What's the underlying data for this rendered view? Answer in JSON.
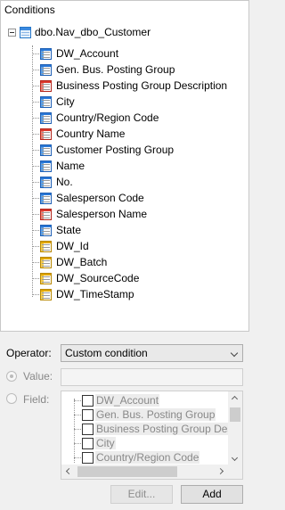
{
  "conditions": {
    "group_title": "Conditions",
    "root_label": "dbo.Nav_dbo_Customer",
    "fields": [
      {
        "label": "DW_Account",
        "color": "blue"
      },
      {
        "label": "Gen. Bus. Posting Group",
        "color": "blue"
      },
      {
        "label": "Business Posting Group Description",
        "color": "red"
      },
      {
        "label": "City",
        "color": "blue"
      },
      {
        "label": "Country/Region Code",
        "color": "blue"
      },
      {
        "label": "Country Name",
        "color": "red"
      },
      {
        "label": "Customer Posting Group",
        "color": "blue"
      },
      {
        "label": "Name",
        "color": "blue"
      },
      {
        "label": "No.",
        "color": "blue"
      },
      {
        "label": "Salesperson Code",
        "color": "blue"
      },
      {
        "label": "Salesperson Name",
        "color": "red"
      },
      {
        "label": "State",
        "color": "blue"
      },
      {
        "label": "DW_Id",
        "color": "yellow"
      },
      {
        "label": "DW_Batch",
        "color": "yellow"
      },
      {
        "label": "DW_SourceCode",
        "color": "yellow"
      },
      {
        "label": "DW_TimeStamp",
        "color": "yellow"
      }
    ]
  },
  "operator": {
    "label": "Operator:",
    "selected": "Custom condition"
  },
  "value": {
    "label": "Value:",
    "text": ""
  },
  "field": {
    "label": "Field:",
    "items": [
      "DW_Account",
      "Gen. Bus. Posting Group",
      "Business Posting Group Descrip",
      "City",
      "Country/Region Code"
    ]
  },
  "buttons": {
    "edit": "Edit...",
    "add": "Add"
  },
  "colors": {
    "blue": "#2b78d6",
    "red": "#d9362b",
    "yellow": "#e0a600"
  }
}
